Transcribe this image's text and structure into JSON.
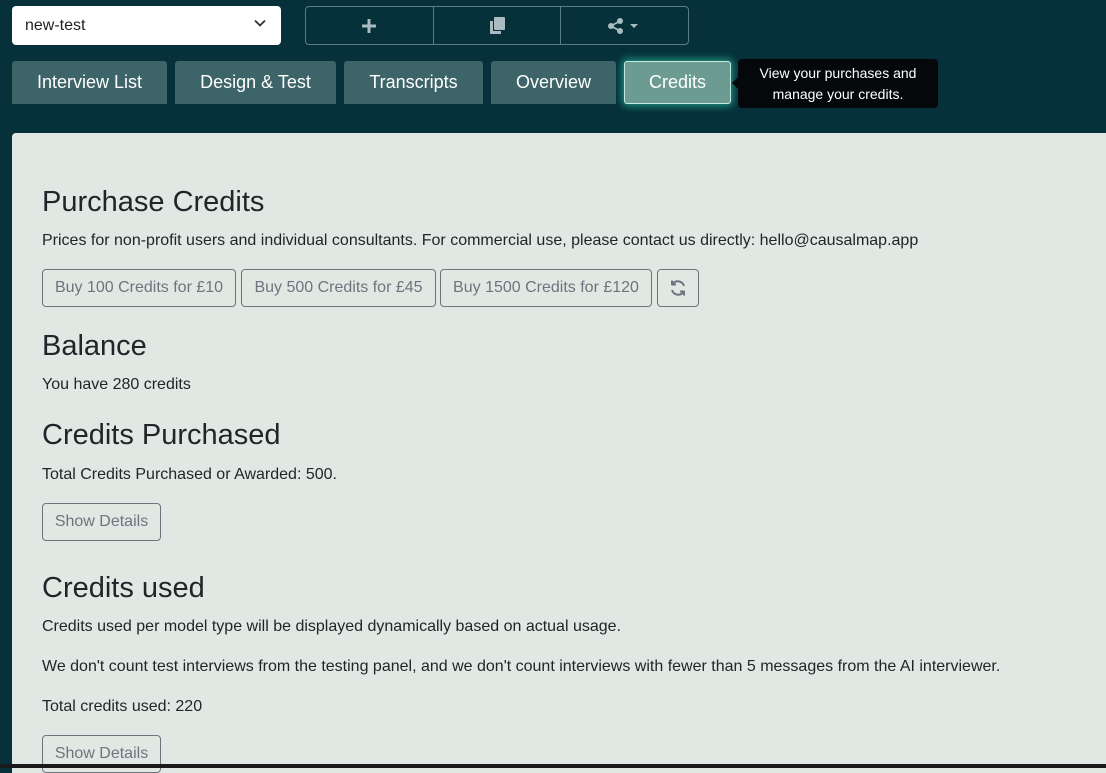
{
  "header": {
    "project_select_value": "new-test",
    "toolbar_icons": [
      "plus-icon",
      "copy-icon",
      "share-icon"
    ]
  },
  "tabs": [
    {
      "label": "Interview List",
      "active": false
    },
    {
      "label": "Design & Test",
      "active": false
    },
    {
      "label": "Transcripts",
      "active": false
    },
    {
      "label": "Overview",
      "active": false
    },
    {
      "label": "Credits",
      "active": true
    }
  ],
  "tooltip": {
    "text": "View your purchases and manage your credits."
  },
  "purchase": {
    "title": "Purchase Credits",
    "description": "Prices for non-profit users and individual consultants. For commercial use, please contact us directly: hello@causalmap.app",
    "buttons": [
      "Buy 100 Credits for £10",
      "Buy 500 Credits for £45",
      "Buy 1500 Credits for £120"
    ],
    "refresh_icon": "refresh-icon"
  },
  "balance": {
    "title": "Balance",
    "text": "You have 280 credits"
  },
  "purchased": {
    "title": "Credits Purchased",
    "text": "Total Credits Purchased or Awarded: 500.",
    "details_label": "Show Details"
  },
  "used": {
    "title": "Credits used",
    "text1": "Credits used per model type will be displayed dynamically based on actual usage.",
    "text2": "We don't count test interviews from the testing panel, and we don't count interviews with fewer than 5 messages from the AI interviewer.",
    "total": "Total credits used: 220",
    "details_label": "Show Details"
  },
  "colors": {
    "background": "#06313a",
    "tab": "#3d6468",
    "tab_active": "#6b9b91",
    "panel": "#e1e8e4",
    "button_outline": "#6c757d"
  }
}
